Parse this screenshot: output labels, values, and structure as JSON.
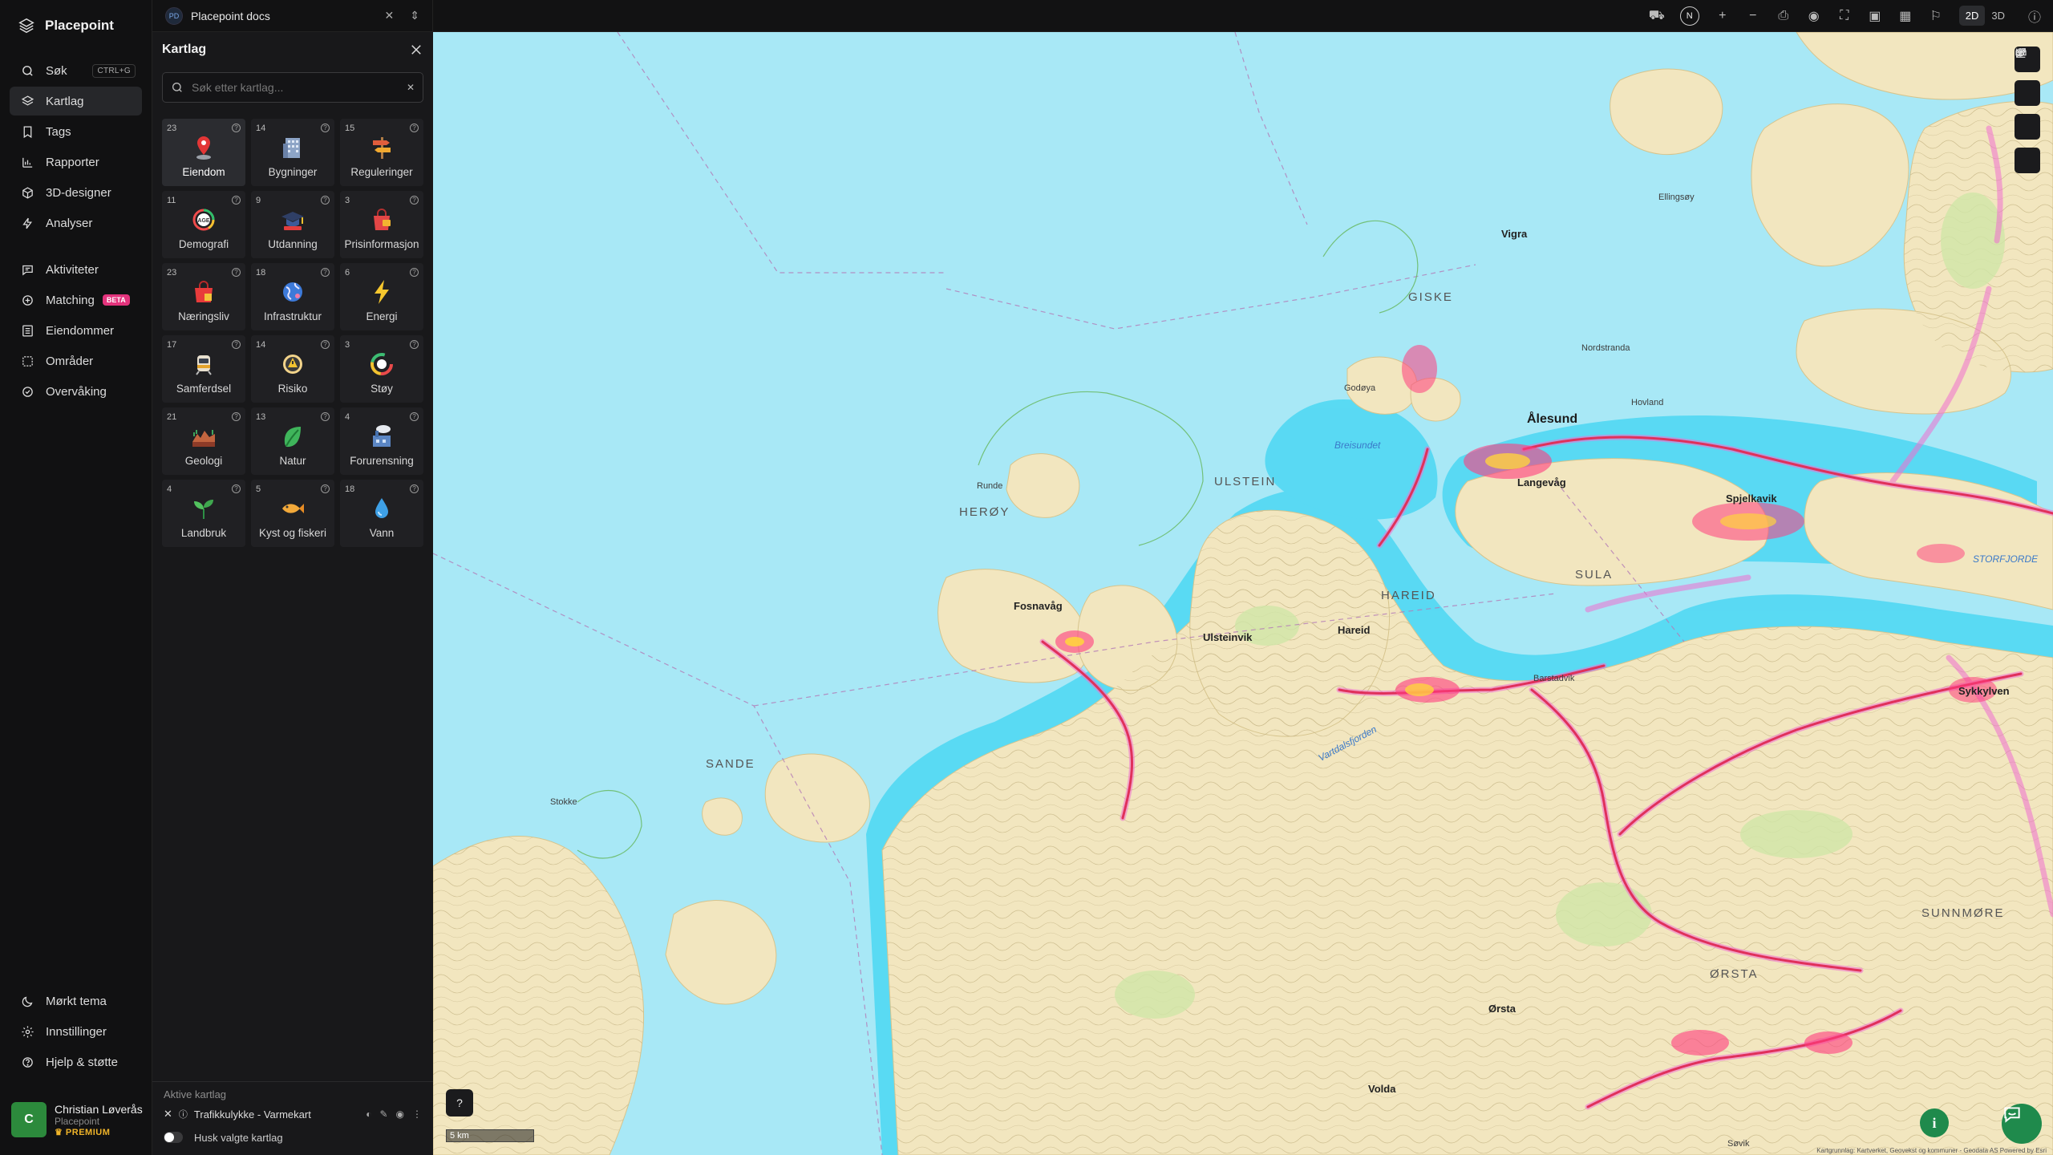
{
  "app": {
    "brand": "Placepoint"
  },
  "nav": {
    "items": [
      {
        "label": "Søk",
        "shortcut": "CTRL+G",
        "icon": "search-icon"
      },
      {
        "label": "Kartlag",
        "icon": "layers-icon",
        "active": true
      },
      {
        "label": "Tags",
        "icon": "bookmark-icon"
      },
      {
        "label": "Rapporter",
        "icon": "bar-chart-icon"
      },
      {
        "label": "3D-designer",
        "icon": "cube-icon"
      },
      {
        "label": "Analyser",
        "icon": "lightning-icon"
      },
      {
        "label": "Aktiviteter",
        "icon": "message-icon"
      },
      {
        "label": "Matching",
        "badge": "BETA",
        "icon": "handshake-icon"
      },
      {
        "label": "Eiendommer",
        "icon": "building-list-icon"
      },
      {
        "label": "Områder",
        "icon": "area-icon"
      },
      {
        "label": "Overvåking",
        "icon": "check-circle-icon"
      }
    ],
    "bottom": [
      {
        "label": "Mørkt tema",
        "icon": "moon-icon"
      },
      {
        "label": "Innstillinger",
        "icon": "gear-icon"
      },
      {
        "label": "Hjelp & støtte",
        "icon": "help-icon"
      }
    ],
    "user": {
      "initial": "C",
      "name": "Christian Løverås",
      "org": "Placepoint",
      "plan": "PREMIUM"
    }
  },
  "topbar": {
    "workspace_badge": "PD",
    "workspace_name": "Placepoint docs",
    "compass": "N",
    "modes": [
      "2D",
      "3D"
    ],
    "active_mode": "2D"
  },
  "panel": {
    "title": "Kartlag",
    "search_placeholder": "Søk etter kartlag...",
    "cards": [
      {
        "count": "23",
        "label": "Eiendom",
        "icon": "pin-icon",
        "selected": true
      },
      {
        "count": "14",
        "label": "Bygninger",
        "icon": "building-icon"
      },
      {
        "count": "15",
        "label": "Reguleringer",
        "icon": "signpost-icon"
      },
      {
        "count": "11",
        "label": "Demografi",
        "icon": "age-icon"
      },
      {
        "count": "9",
        "label": "Utdanning",
        "icon": "graduation-icon"
      },
      {
        "count": "3",
        "label": "Prisinformasjon",
        "icon": "price-bag-icon"
      },
      {
        "count": "23",
        "label": "Næringsliv",
        "icon": "shopping-bag-icon"
      },
      {
        "count": "18",
        "label": "Infrastruktur",
        "icon": "globe-icon"
      },
      {
        "count": "6",
        "label": "Energi",
        "icon": "bolt-icon"
      },
      {
        "count": "17",
        "label": "Samferdsel",
        "icon": "train-icon"
      },
      {
        "count": "14",
        "label": "Risiko",
        "icon": "warning-icon"
      },
      {
        "count": "3",
        "label": "Støy",
        "icon": "noise-gauge-icon"
      },
      {
        "count": "21",
        "label": "Geologi",
        "icon": "terrain-icon"
      },
      {
        "count": "13",
        "label": "Natur",
        "icon": "leaf-icon"
      },
      {
        "count": "4",
        "label": "Forurensning",
        "icon": "factory-icon"
      },
      {
        "count": "4",
        "label": "Landbruk",
        "icon": "sprout-icon"
      },
      {
        "count": "5",
        "label": "Kyst og fiskeri",
        "icon": "fish-icon"
      },
      {
        "count": "18",
        "label": "Vann",
        "icon": "water-drop-icon"
      }
    ],
    "active_title": "Aktive kartlag",
    "active_layer": "Trafikkulykke - Varmekart",
    "remember_label": "Husk valgte kartlag"
  },
  "map": {
    "scale_label": "5 km",
    "attribution": "Kartgrunnlag: Kartverket, Geovekst og kommuner - Geodata AS Powered by Esri",
    "labels": {
      "alesund": "Ålesund",
      "ulsteinvik": "Ulsteinvik",
      "fosnavag": "Fosnavåg",
      "hareid": "Hareid",
      "langevag": "Langevåg",
      "spjelkavik": "Spjelkavik",
      "volda": "Volda",
      "orsta": "Ørsta",
      "sykkylven": "Sykkylven",
      "vigra": "Vigra",
      "giske": "GISKE",
      "heroy": "HERØY",
      "ulstein": "ULSTEIN",
      "sande": "SANDE",
      "hareid_r": "HAREID",
      "sula": "SULA",
      "orsta_r": "ØRSTA",
      "sunnmore": "SUNNMØRE",
      "breisundet": "Breisundet",
      "vartdalsfjorden": "Vartdalsfjorden",
      "storfjorden": "STORFJORDE",
      "hovland": "Hovland",
      "nordstranda": "Nordstranda",
      "runde": "Runde",
      "godoya": "Godøya",
      "ellingsoy": "Ellingsøy",
      "barstadvik": "Barstadvik",
      "sovik": "Søvik",
      "stokke": "Stokke"
    }
  }
}
